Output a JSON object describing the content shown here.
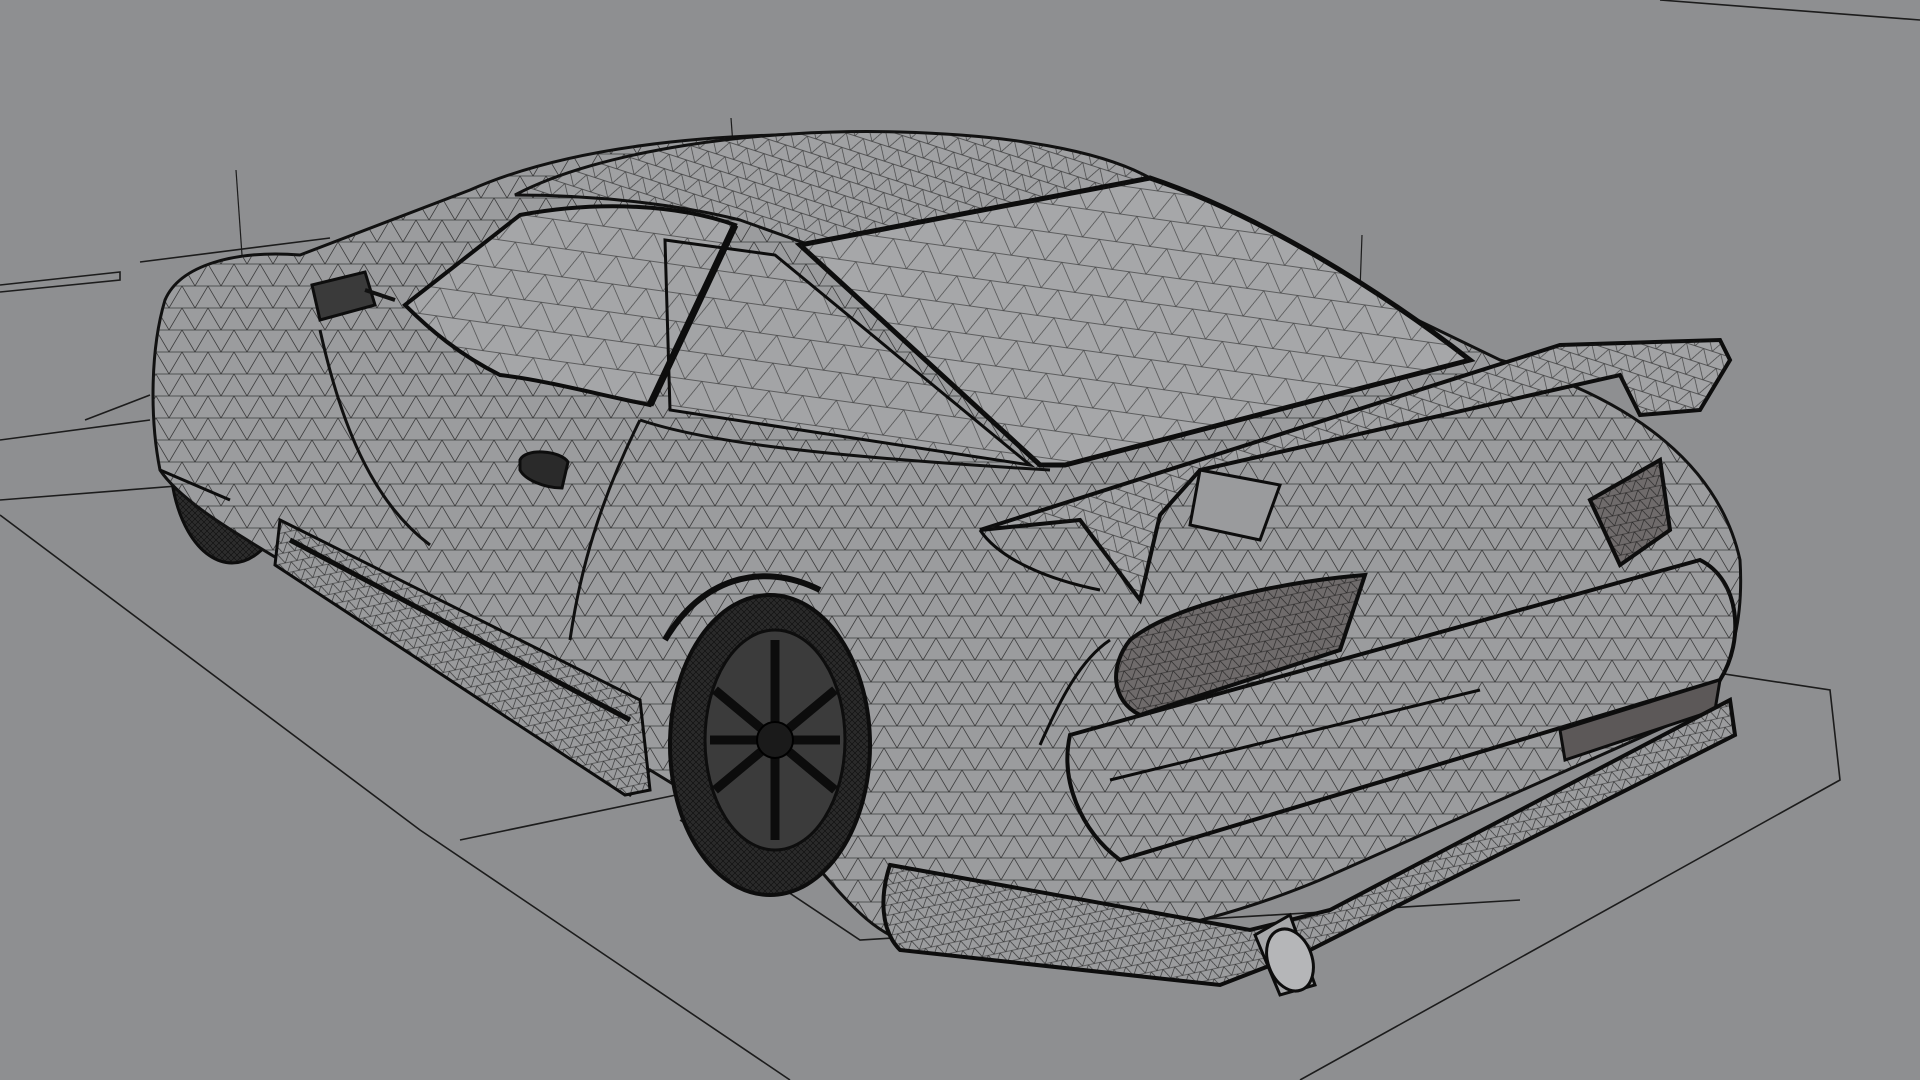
{
  "viewport": {
    "view": "perspective-3d",
    "shading": "wireframe",
    "background_color": "#8e8f91",
    "wire_color": "#111111",
    "body_fill": "#9a9a9c",
    "glass_fill": "#a4a5a7",
    "tire_fill": "#2a2a2a",
    "taillight_fill": "#6e6a6a"
  },
  "model": {
    "subject": "sports-coupe",
    "visible_parts": [
      "body-shell",
      "roof",
      "rear-windshield",
      "side-window",
      "side-mirror",
      "door-handle",
      "rear-spoiler",
      "taillight-left",
      "taillight-right",
      "rear-bumper",
      "rear-diffuser",
      "exhaust-pipe",
      "side-skirt",
      "front-wheel",
      "rear-wheel"
    ]
  },
  "scene_guides": {
    "ground_plane_outline": true,
    "pivot_markers": 4
  }
}
